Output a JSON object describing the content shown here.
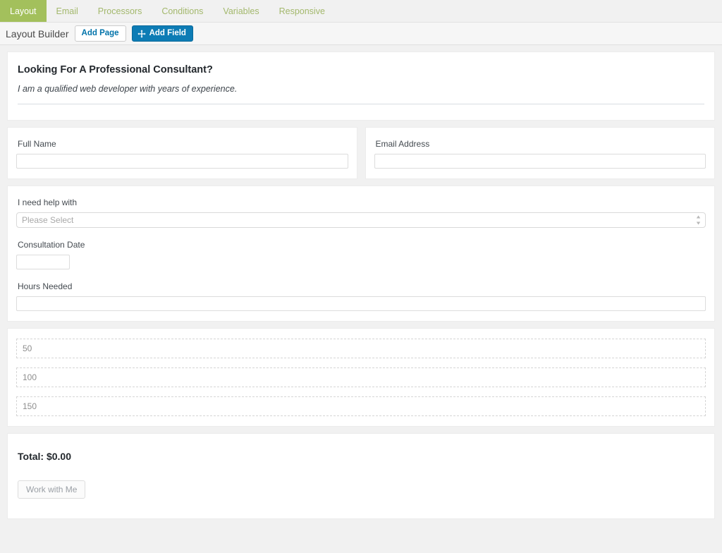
{
  "tabs": [
    {
      "label": "Layout",
      "active": true
    },
    {
      "label": "Email",
      "active": false
    },
    {
      "label": "Processors",
      "active": false
    },
    {
      "label": "Conditions",
      "active": false
    },
    {
      "label": "Variables",
      "active": false
    },
    {
      "label": "Responsive",
      "active": false
    }
  ],
  "toolbar": {
    "title": "Layout Builder",
    "add_page_label": "Add Page",
    "add_field_label": "Add Field",
    "add_field_icon": "move-arrows-icon"
  },
  "form": {
    "heading": "Looking For A Professional Consultant?",
    "subtext": "I am a qualified web developer with years of experience.",
    "fields": {
      "full_name": {
        "label": "Full Name",
        "value": "",
        "placeholder": ""
      },
      "email_address": {
        "label": "Email Address",
        "value": "",
        "placeholder": ""
      },
      "help_with": {
        "label": "I need help with",
        "selected": "Please Select"
      },
      "consultation_date": {
        "label": "Consultation Date",
        "value": "",
        "placeholder": ""
      },
      "hours_needed": {
        "label": "Hours Needed",
        "value": "",
        "placeholder": ""
      }
    },
    "dashed_rows": [
      {
        "text": "50"
      },
      {
        "text": "100"
      },
      {
        "text": "150"
      }
    ],
    "total_label": "Total: $0.00",
    "submit_label": "Work with Me"
  },
  "colors": {
    "tab_active_bg": "#a3c05c",
    "tab_text": "#a3b86c",
    "primary_button_bg": "#0d7cb5",
    "link_blue": "#0073aa",
    "page_bg": "#f1f1f1"
  }
}
